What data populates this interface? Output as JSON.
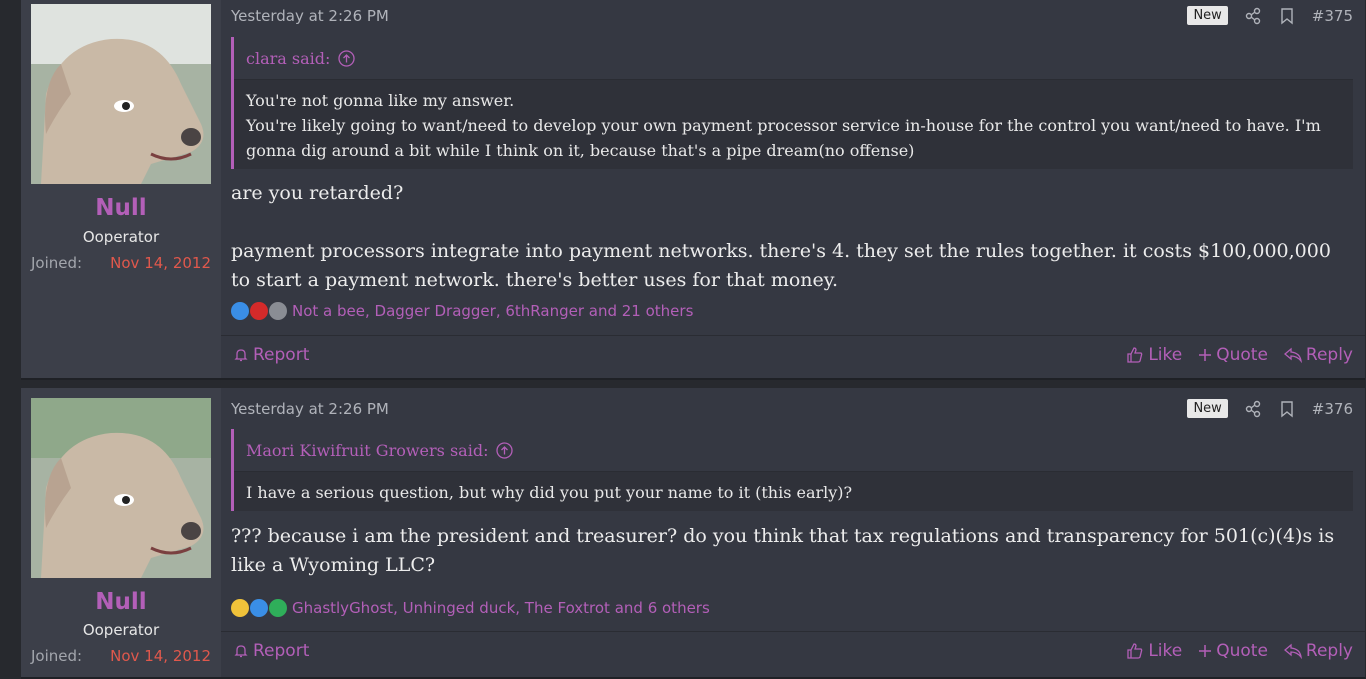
{
  "posts": [
    {
      "date": "Yesterday at 2:26 PM",
      "badge": "New",
      "number": "#375",
      "user": {
        "name": "Null",
        "title": "Ooperator",
        "joined_label": "Joined:",
        "joined_value": "Nov 14, 2012"
      },
      "quote": {
        "author": "clara said:",
        "lines": [
          "You're not gonna like my answer.",
          "You're likely going to want/need to develop your own payment processor service in-house for the control you want/need to have. I'm gonna dig around a bit while I think on it, because that's a pipe dream(no offense)"
        ]
      },
      "message": [
        "are you retarded?",
        "payment processors integrate into payment networks. there's 4. they set the rules together. it costs $100,000,000 to start a payment network. there's better uses for that money."
      ],
      "reactions": {
        "icons": [
          "like-icon",
          "heart-icon",
          "wrench-icon"
        ],
        "names": "Not a bee, Dagger Dragger, 6thRanger and 21 others"
      },
      "footer": {
        "report": "Report",
        "like": "Like",
        "quote": "Quote",
        "reply": "Reply"
      }
    },
    {
      "date": "Yesterday at 2:26 PM",
      "badge": "New",
      "number": "#376",
      "user": {
        "name": "Null",
        "title": "Ooperator",
        "joined_label": "Joined:",
        "joined_value": "Nov 14, 2012"
      },
      "quote": {
        "author": "Maori Kiwifruit Growers said:",
        "lines": [
          "I have a serious question, but why did you put your name to it (this early)?"
        ]
      },
      "message": [
        "??? because i am the president and treasurer? do you think that tax regulations and transparency for 501(c)(4)s is like a Wyoming LLC?"
      ],
      "reactions": {
        "icons": [
          "thinking-icon",
          "like-icon",
          "checkmark-icon"
        ],
        "names": "GhastlyGhost, Unhinged duck, The Foxtrot and 6 others"
      },
      "footer": {
        "report": "Report",
        "like": "Like",
        "quote": "Quote",
        "reply": "Reply"
      }
    }
  ],
  "colors": {
    "accent": "#b35fb8",
    "joined": "#e0584c",
    "background": "#27292e",
    "post_bg": "#353842"
  }
}
